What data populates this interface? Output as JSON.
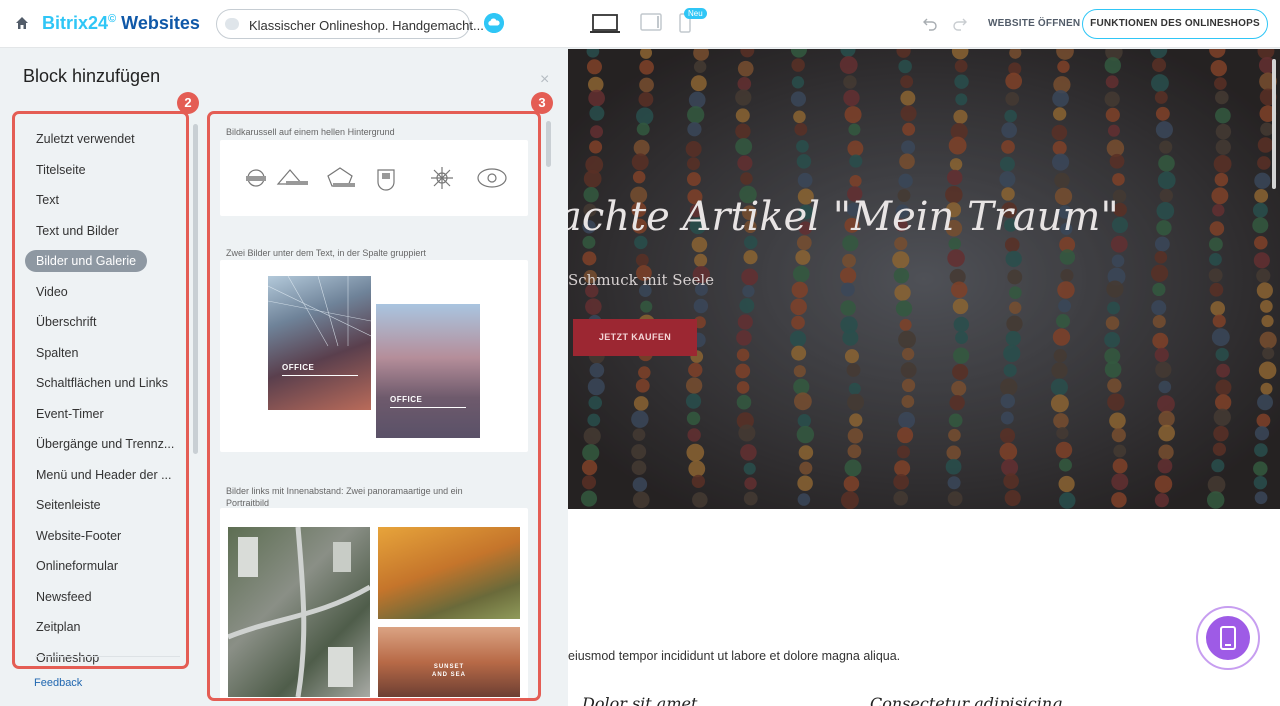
{
  "topbar": {
    "brand_part1": "Bitrix24",
    "brand_clock": "©",
    "brand_part2": "Websites",
    "site_select": "Klassischer Onlineshop. Handgemacht...",
    "new_badge": "Neu",
    "open_site": "WEBSITE ÖFFNEN",
    "shop_features": "FUNKTIONEN DES ONLINESHOPS"
  },
  "panel": {
    "title": "Block hinzufügen",
    "close": "×",
    "categories": [
      {
        "label": "Zuletzt verwendet"
      },
      {
        "label": "Titelseite"
      },
      {
        "label": "Text"
      },
      {
        "label": "Text und Bilder"
      },
      {
        "label": "Bilder und Galerie"
      },
      {
        "label": "Video"
      },
      {
        "label": "Überschrift"
      },
      {
        "label": "Spalten"
      },
      {
        "label": "Schaltflächen und Links"
      },
      {
        "label": "Event-Timer"
      },
      {
        "label": "Übergänge und Trennz..."
      },
      {
        "label": "Menü und Header der ..."
      },
      {
        "label": "Seitenleiste"
      },
      {
        "label": "Website-Footer"
      },
      {
        "label": "Onlineformular"
      },
      {
        "label": "Newsfeed"
      },
      {
        "label": "Zeitplan"
      },
      {
        "label": "Onlineshop"
      }
    ],
    "active_category": "Bilder und Galerie",
    "feedback": "Feedback",
    "badge_left": "2",
    "badge_right": "3",
    "blocks": [
      {
        "label": "Bildkarussell auf einem hellen Hintergrund"
      },
      {
        "label": "Zwei Bilder unter dem Text, in der Spalte gruppiert"
      },
      {
        "label": "Bilder links mit Innenabstand: Zwei panoramaartige und ein Portraitbild"
      }
    ],
    "office_label": "OFFICE",
    "office_label_2": "OFFICE",
    "sunset_label_1": "SUNSET",
    "sunset_label_2": "AND SEA"
  },
  "preview": {
    "hero_title": "achte Artikel \"Mein Traum\"",
    "hero_subtitle": "Schmuck mit Seele",
    "hero_button": "JETZT KAUFEN",
    "body_text": "eiusmod tempor incididunt ut labore et dolore magna aliqua.",
    "col_heading_1": "Dolor sit amet",
    "col_heading_2": "Consectetur adipisicing"
  },
  "colors": {
    "accent": "#2fc6f6",
    "highlight": "#e45d54",
    "hero_button": "#9c2732",
    "mobile_fab": "#9e5be6"
  }
}
